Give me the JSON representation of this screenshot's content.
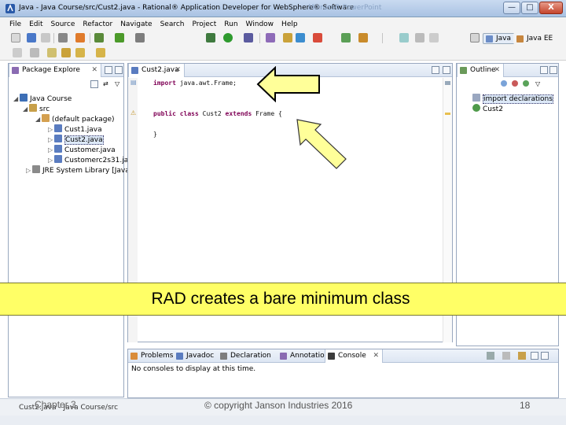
{
  "window": {
    "title": "Java - Java Course/src/Cust2.java - Rational® Application Developer for WebSphere® Software",
    "title_ghost": "Microsoft PowerPoint",
    "minimize": "—",
    "maximize": "□",
    "close": "X"
  },
  "menu": [
    "File",
    "Edit",
    "Source",
    "Refactor",
    "Navigate",
    "Search",
    "Project",
    "Run",
    "Window",
    "Help"
  ],
  "perspectives": {
    "java": "Java",
    "javaee": "Java EE"
  },
  "package_explorer": {
    "tab_label": "Package Explore",
    "tree": {
      "project": "Java Course",
      "src": "src",
      "package": "(default package)",
      "files": [
        "Cust1.java",
        "Cust2.java",
        "Customer.java",
        "Customerc2s31.ja"
      ],
      "library": "JRE System Library [Java SE"
    },
    "selected_file": "Cust2.java"
  },
  "editor": {
    "tab_label": "Cust2.java",
    "lines": {
      "import_kw": "import",
      "import_rest": " java.awt.Frame;",
      "public_kw": "public",
      "class_kw": "class",
      "class_name": " Cust2 ",
      "extends_kw": "extends",
      "frame_rest": " Frame {",
      "brace_close": "}"
    }
  },
  "outline": {
    "tab_label": "Outline",
    "items": [
      "import declarations",
      "Cust2"
    ]
  },
  "bottom_panel": {
    "tabs": [
      "Problems",
      "Javadoc",
      "Declaration",
      "Annotations",
      "Console"
    ],
    "console_message": "No consoles to display at this time."
  },
  "banner": {
    "text": "RAD creates a bare minimum class"
  },
  "status": {
    "text": "Cust2.java - Java Course/src"
  },
  "footer": {
    "chapter": "Chapter 3",
    "copyright": "© copyright Janson Industries 2016",
    "page": "18"
  },
  "colors": {
    "banner": "#ffff66",
    "arrow": "#ffff99",
    "selection": "#3399ff",
    "keyword": "#7f0055"
  }
}
